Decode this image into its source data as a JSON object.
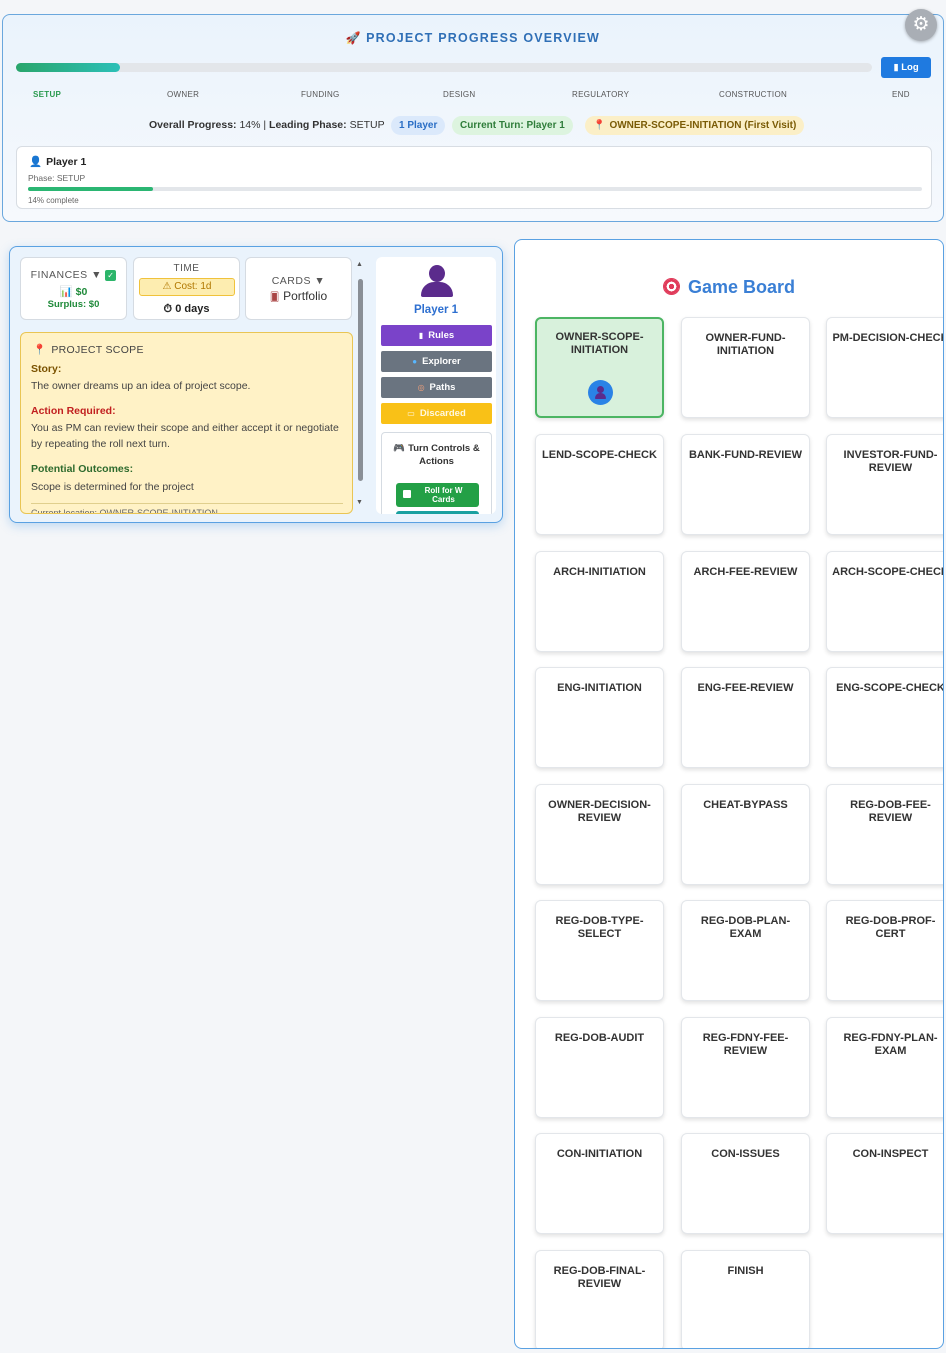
{
  "overview": {
    "title": "PROJECT PROGRESS OVERVIEW",
    "log_label": "Log",
    "progress_fraction": 0.14,
    "phases": [
      "SETUP",
      "OWNER",
      "FUNDING",
      "DESIGN",
      "REGULATORY",
      "CONSTRUCTION",
      "END"
    ],
    "active_phase": "SETUP",
    "overall_label": "Overall Progress:",
    "overall_value": "14%",
    "leading_label": "Leading Phase:",
    "leading_value": "SETUP",
    "players_pill": "1 Player",
    "turn_pill": "Current Turn: Player 1",
    "space_pill": "OWNER-SCOPE-INITIATION (First Visit)",
    "player_card": {
      "name": "Player 1",
      "phase": "Phase: SETUP",
      "progress_fraction": 0.14,
      "complete": "14% complete"
    }
  },
  "finances": {
    "title": "FINANCES ▼",
    "amount": "$0",
    "surplus": "Surplus: $0"
  },
  "time": {
    "title": "TIME",
    "cost": "Cost: 1d",
    "days": "0 days"
  },
  "cards": {
    "title": "CARDS ▼",
    "portfolio": "Portfolio"
  },
  "scope": {
    "title": "PROJECT SCOPE",
    "story_label": "Story:",
    "story": "The owner dreams up an idea of project scope.",
    "action_label": "Action Required:",
    "action": "You as PM can review their scope and either accept it or negotiate by repeating the roll next turn.",
    "outcome_label": "Potential Outcomes:",
    "outcome": "Scope is determined for the project",
    "footer": "Current location: OWNER-SCOPE-INITIATION"
  },
  "player_panel": {
    "name": "Player 1",
    "rules": "Rules",
    "explorer": "Explorer",
    "paths": "Paths",
    "discarded": "Discarded",
    "turn_title": "Turn Controls & Actions",
    "roll": "Roll for W Cards"
  },
  "board": {
    "title": "Game Board",
    "spaces": [
      "OWNER-SCOPE-INITIATION",
      "OWNER-FUND-INITIATION",
      "PM-DECISION-CHECK",
      "LEND-SCOPE-CHECK",
      "BANK-FUND-REVIEW",
      "INVESTOR-FUND-REVIEW",
      "ARCH-INITIATION",
      "ARCH-FEE-REVIEW",
      "ARCH-SCOPE-CHECK",
      "ENG-INITIATION",
      "ENG-FEE-REVIEW",
      "ENG-SCOPE-CHECK",
      "OWNER-DECISION-REVIEW",
      "CHEAT-BYPASS",
      "REG-DOB-FEE-REVIEW",
      "REG-DOB-TYPE-SELECT",
      "REG-DOB-PLAN-EXAM",
      "REG-DOB-PROF-CERT",
      "REG-DOB-AUDIT",
      "REG-FDNY-FEE-REVIEW",
      "REG-FDNY-PLAN-EXAM",
      "CON-INITIATION",
      "CON-ISSUES",
      "CON-INSPECT",
      "REG-DOB-FINAL-REVIEW",
      "FINISH"
    ],
    "current_space": "OWNER-SCOPE-INITIATION"
  }
}
